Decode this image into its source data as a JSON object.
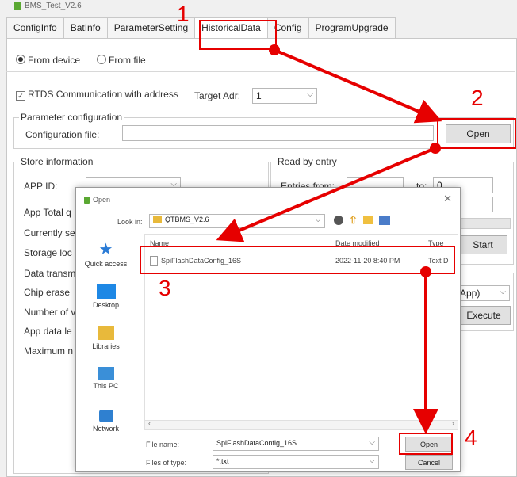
{
  "window": {
    "title": "BMS_Test_V2.6"
  },
  "tabs": [
    "ConfigInfo",
    "BatInfo",
    "ParameterSetting",
    "HistoricalData",
    "Config",
    "ProgramUpgrade"
  ],
  "source": {
    "from_device": "From device",
    "from_file": "From file"
  },
  "rtds": {
    "label": "RTDS Communication with address",
    "target_label": "Target Adr:",
    "target_value": "1"
  },
  "param_config": {
    "legend": "Parameter configuration",
    "file_label": "Configuration file:",
    "file_value": "",
    "open": "Open"
  },
  "store": {
    "legend": "Store information",
    "app_id": "APP ID:",
    "rows": [
      "App Total q",
      "Currently se",
      "Storage loc",
      "Data transm",
      "Chip erase",
      "Number of v",
      "App data le",
      "Maximum n"
    ]
  },
  "read": {
    "legend": "Read by entry",
    "entries_from": "Entries from:",
    "to": "to:",
    "to_value": "0",
    "start": "Start",
    "app_combo": "App)",
    "execute": "Execute"
  },
  "dialog": {
    "title": "Open",
    "look_in_label": "Look in:",
    "look_in_value": "QTBMS_V2.6",
    "columns": {
      "name": "Name",
      "date": "Date modified",
      "type": "Type"
    },
    "file": {
      "name": "SpiFlashDataConfig_16S",
      "date": "2022-11-20 8:40 PM",
      "type": "Text D"
    },
    "nav": [
      "Quick access",
      "Desktop",
      "Libraries",
      "This PC",
      "Network"
    ],
    "file_name_label": "File name:",
    "file_name_value": "SpiFlashDataConfig_16S",
    "file_type_label": "Files of type:",
    "file_type_value": "*.txt",
    "open": "Open",
    "cancel": "Cancel"
  },
  "annotations": [
    "1",
    "2",
    "3",
    "4"
  ],
  "colors": {
    "annotation": "#e60000"
  }
}
